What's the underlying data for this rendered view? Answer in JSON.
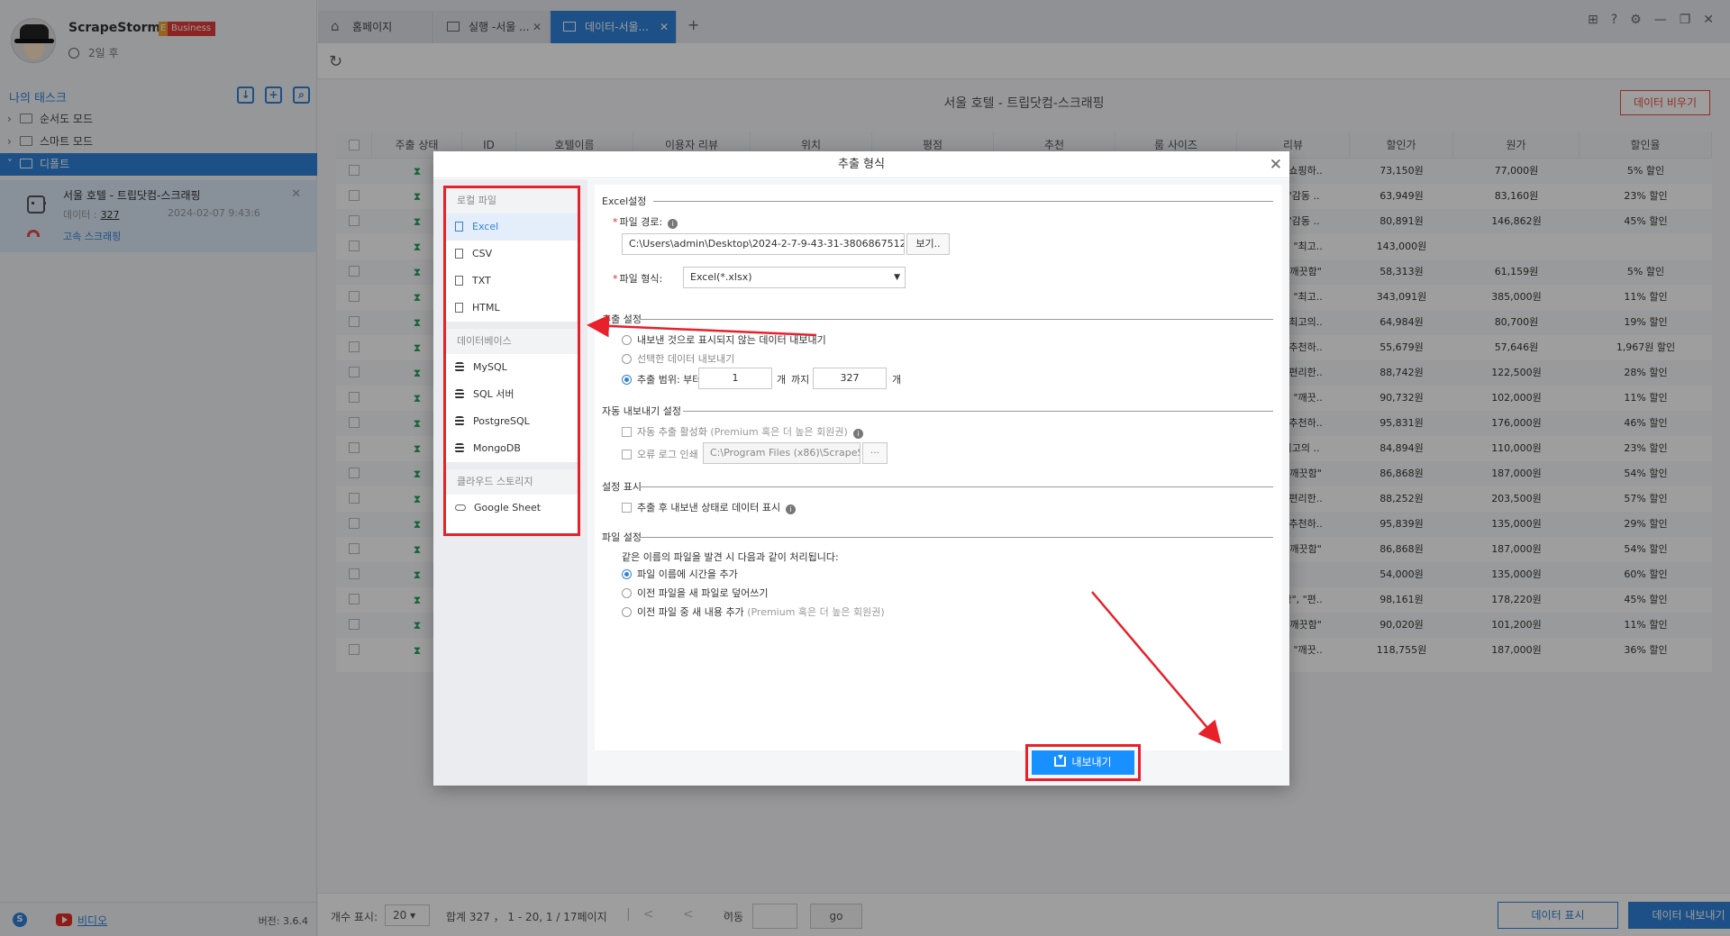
{
  "app": {
    "name": "ScrapeStorm",
    "plan": "Business",
    "expiry": "2일 후",
    "version": "버전: 3.6.4"
  },
  "sidebar": {
    "header": "나의 태스크",
    "items": [
      {
        "label": "순서도 모드"
      },
      {
        "label": "스마트 모드"
      },
      {
        "label": "디폴트"
      }
    ],
    "task": {
      "title": "서울 호텔 - 트립닷컴-스크래핑",
      "data_label": "데이터 :",
      "data_count": "327",
      "date": "2024-02-07 9:43:6",
      "speed": "고속 스크래핑"
    },
    "video": "비디오"
  },
  "tabs": [
    {
      "label": "홈페이지"
    },
    {
      "label": "실행 -서울 ..."
    },
    {
      "label": "데이터-서울..."
    }
  ],
  "main": {
    "title": "서울 호텔 - 트립닷컴-스크래핑",
    "clear_btn": "데이터 비우기",
    "columns": [
      "주출 상태",
      "ID",
      "호텔이름",
      "이용자 리뷰",
      "위치",
      "평점",
      "추천",
      "룸 사이즈",
      "리뷰",
      "할인가",
      "원가",
      "할인율"
    ],
    "rows": [
      {
        "review": "지\", \"쇼핑하..",
        "sale": "73,150원",
        "orig": "77,000원",
        "rate": "5% 할인"
      },
      {
        "review": "지\", \"감동 ..",
        "sale": "63,949원",
        "orig": "83,160원",
        "rate": "23% 할인"
      },
      {
        "review": "지\", \"감동 ..",
        "sale": "80,891원",
        "orig": "146,862원",
        "rate": "45% 할인"
      },
      {
        "review": "숙소\", \"최고..",
        "sale": "143,000원",
        "orig": "",
        "rate": ""
      },
      {
        "review": "지\", \"깨끗함\"",
        "sale": "58,313원",
        "orig": "61,159원",
        "rate": "5% 할인"
      },
      {
        "review": "숙소\", \"최고..",
        "sale": "343,091원",
        "orig": "385,000원",
        "rate": "11% 할인"
      },
      {
        "review": "지\", \"최고의..",
        "sale": "64,984원",
        "orig": "80,700원",
        "rate": "19% 할인"
      },
      {
        "review": "지\", \"추천하..",
        "sale": "55,679원",
        "orig": "57,646원",
        "rate": "1,967원 할인"
      },
      {
        "review": "룸\", \"편리한..",
        "sale": "88,742원",
        "orig": "122,500원",
        "rate": "28% 할인"
      },
      {
        "review": "숙소\", \"깨끗..",
        "sale": "90,732원",
        "orig": "102,000원",
        "rate": "11% 할인"
      },
      {
        "review": "지\", \"추천하..",
        "sale": "95,831원",
        "orig": "176,000원",
        "rate": "46% 할인"
      },
      {
        "review": "\", \"최고의 ..",
        "sale": "84,894원",
        "orig": "110,000원",
        "rate": "23% 할인"
      },
      {
        "review": "룸\", \"깨끗함\"",
        "sale": "86,868원",
        "orig": "187,000원",
        "rate": "54% 할인"
      },
      {
        "review": "룸\", \"편리한..",
        "sale": "88,252원",
        "orig": "203,500원",
        "rate": "57% 할인"
      },
      {
        "review": "지\", \"추천하..",
        "sale": "95,839원",
        "orig": "135,000원",
        "rate": "29% 할인"
      },
      {
        "review": "룸\", \"깨끗함\"",
        "sale": "86,868원",
        "orig": "187,000원",
        "rate": "54% 할인"
      },
      {
        "review": "",
        "sale": "54,000원",
        "orig": "135,000원",
        "rate": "60% 할인"
      },
      {
        "review": "편리함\", \"편..",
        "sale": "98,161원",
        "orig": "178,220원",
        "rate": "45% 할인"
      },
      {
        "review": "지\", \"깨끗함\"",
        "sale": "90,020원",
        "orig": "101,200원",
        "rate": "11% 할인"
      },
      {
        "review": "숙소\", \"깨끗..",
        "sale": "118,755원",
        "orig": "187,000원",
        "rate": "36% 할인"
      }
    ]
  },
  "pager": {
    "per_page_label": "개수 표시:",
    "per_page": "20",
    "summary": "합계 327 ， 1 - 20, 1 / 17페이지",
    "nav": "|< < > >|",
    "goto_label": "이동",
    "go": "go",
    "show_btn": "데이터 표시",
    "export_btn": "데이터 내보내기"
  },
  "modal": {
    "title": "추출 형식",
    "groups": {
      "local": "로컬 파일",
      "database": "데이터베이스",
      "cloud": "클라우드 스토리지"
    },
    "local_options": [
      "Excel",
      "CSV",
      "TXT",
      "HTML"
    ],
    "db_options": [
      "MySQL",
      "SQL 서버",
      "PostgreSQL",
      "MongoDB"
    ],
    "cloud_options": [
      "Google Sheet"
    ],
    "excel_section": "Excel설정",
    "path_label": "파일 경로:",
    "path_value": "C:\\Users\\admin\\Desktop\\2024-2-7-9-43-31-380686751220",
    "browse": "보기..",
    "format_label": "파일 형식:",
    "format_value": "Excel(*.xlsx)",
    "extract_section": "추출 설정",
    "opt_unexported": "내보낸 것으로 표시되지 않는 데이터 내보내기",
    "opt_selected": "선택한 데이터 내보내기",
    "opt_range": "추출 범위: 부터",
    "range_from": "1",
    "range_unit1": "개",
    "range_to_label": "까지",
    "range_to": "327",
    "range_unit2": "개",
    "auto_section": "자동 내보내기 설정",
    "auto_enable": "자동 추출 활성화",
    "auto_note": "(Premium 혹은 더 높은 회원권)",
    "error_log": "오류 로그 인쇄",
    "error_path": "C:\\Program Files (x86)\\ScrapeStorm\\",
    "error_browse": "···",
    "display_section": "설정 표시",
    "mark_exported": "추출 후 내보낸 상태로 데이터 표시",
    "file_section": "파일 설정",
    "dup_note": "같은 이름의 파일을 발견 시 다음과 같이 처리됩니다:",
    "dup_time": "파일 이름에 시간을 추가",
    "dup_overwrite": "이전 파일을 새 파일로 덮어쓰기",
    "dup_append": "이전 파일 중 새 내용 추가",
    "dup_append_note": "(Premium 혹은 더 높은 회원권)",
    "export": "내보내기"
  },
  "colors": {
    "accent": "#2e82d8",
    "annotation_red": "#e8202a",
    "export_blue": "#1890ff"
  }
}
